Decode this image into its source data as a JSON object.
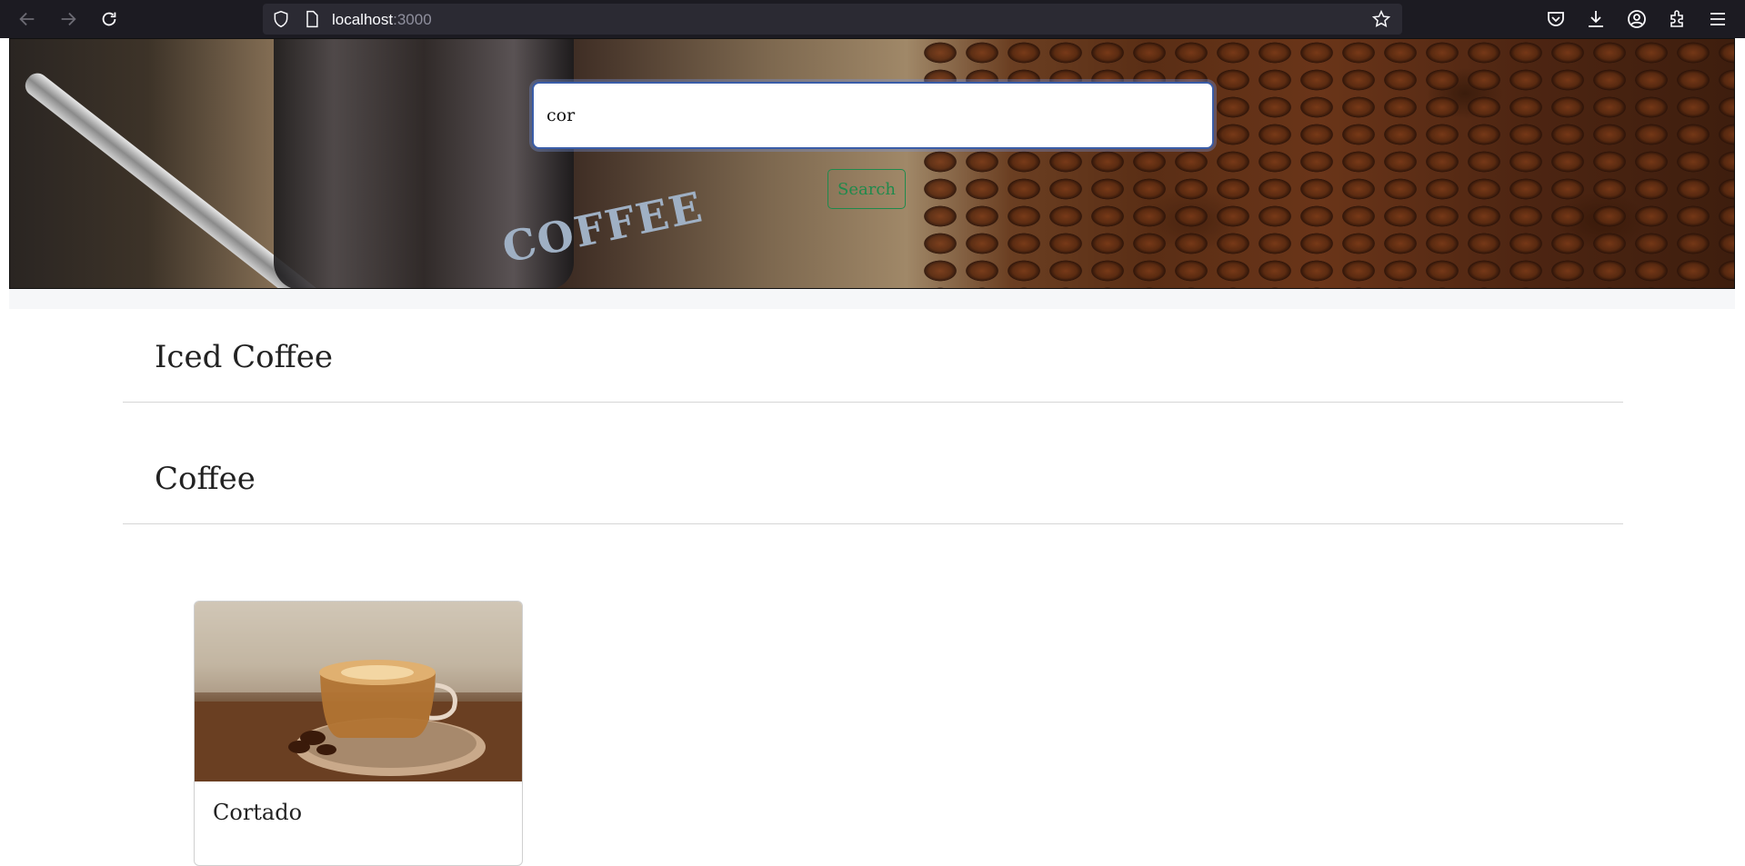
{
  "browser": {
    "url_host": "localhost",
    "url_port": ":3000"
  },
  "search": {
    "value": "cor",
    "button_label": "Search"
  },
  "hero": {
    "label": "COFFEE"
  },
  "categories": [
    {
      "name": "Iced Coffee"
    },
    {
      "name": "Coffee"
    }
  ],
  "cards": [
    {
      "title": "Cortado"
    }
  ]
}
